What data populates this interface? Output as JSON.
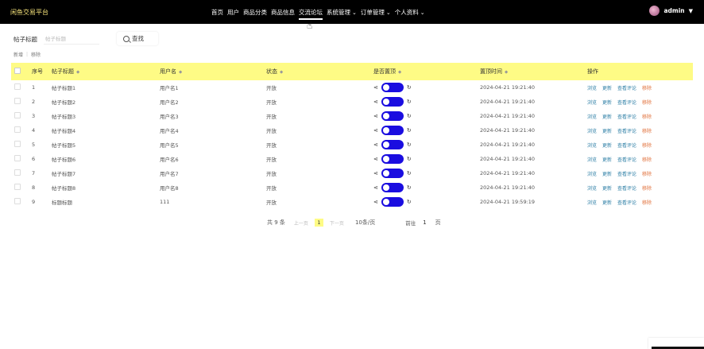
{
  "app": {
    "title": "闲鱼交易平台"
  },
  "nav": {
    "items": [
      {
        "label": "首页",
        "active": false,
        "dropdown": false
      },
      {
        "label": "用户",
        "active": false,
        "dropdown": false
      },
      {
        "label": "商品分类",
        "active": false,
        "dropdown": false
      },
      {
        "label": "商品信息",
        "active": false,
        "dropdown": false
      },
      {
        "label": "交流论坛",
        "active": true,
        "dropdown": false
      },
      {
        "label": "系统管理",
        "active": false,
        "dropdown": true
      },
      {
        "label": "订单管理",
        "active": false,
        "dropdown": true
      },
      {
        "label": "个人资料",
        "active": false,
        "dropdown": true
      }
    ]
  },
  "user": {
    "name": "admin"
  },
  "search": {
    "label": "帖子标题",
    "placeholder": "帖子标题",
    "button_label": "查找"
  },
  "toolbar": {
    "add_label": "新增",
    "delete_label": "移除"
  },
  "table": {
    "headers": {
      "no": "序号",
      "title": "帖子标题",
      "username": "用户名",
      "status": "状态",
      "is_top": "是否置顶",
      "top_time": "置顶时间",
      "actions": "操作"
    },
    "rows": [
      {
        "no": "1",
        "title": "帖子标题1",
        "username": "用户名1",
        "status": "开放",
        "is_top": true,
        "top_time": "2024-04-21 19:21:40"
      },
      {
        "no": "2",
        "title": "帖子标题2",
        "username": "用户名2",
        "status": "开放",
        "is_top": true,
        "top_time": "2024-04-21 19:21:40"
      },
      {
        "no": "3",
        "title": "帖子标题3",
        "username": "用户名3",
        "status": "开放",
        "is_top": true,
        "top_time": "2024-04-21 19:21:40"
      },
      {
        "no": "4",
        "title": "帖子标题4",
        "username": "用户名4",
        "status": "开放",
        "is_top": true,
        "top_time": "2024-04-21 19:21:40"
      },
      {
        "no": "5",
        "title": "帖子标题5",
        "username": "用户名5",
        "status": "开放",
        "is_top": true,
        "top_time": "2024-04-21 19:21:40"
      },
      {
        "no": "6",
        "title": "帖子标题6",
        "username": "用户名6",
        "status": "开放",
        "is_top": true,
        "top_time": "2024-04-21 19:21:40"
      },
      {
        "no": "7",
        "title": "帖子标题7",
        "username": "用户名7",
        "status": "开放",
        "is_top": true,
        "top_time": "2024-04-21 19:21:40"
      },
      {
        "no": "8",
        "title": "帖子标题8",
        "username": "用户名8",
        "status": "开放",
        "is_top": true,
        "top_time": "2024-04-21 19:21:40"
      },
      {
        "no": "9",
        "title": "标题标题",
        "username": "111",
        "status": "开放",
        "is_top": true,
        "top_time": "2024-04-21 19:59:19"
      }
    ],
    "row_actions": {
      "view": "浏览",
      "edit": "更新",
      "comments": "查看评论",
      "delete": "移除"
    }
  },
  "pagination": {
    "total": "共 9 条",
    "prev": "上一页",
    "current_page": "1",
    "next": "下一页",
    "page_size": "10条/页",
    "goto_label": "前往",
    "goto_value": "1",
    "goto_unit": "页"
  },
  "colors": {
    "header_bg": "#000000",
    "table_header_bg": "#fefb85",
    "toggle_on": "#1a0de0",
    "link": "#2e7fa6",
    "danger_link": "#e0703a"
  }
}
